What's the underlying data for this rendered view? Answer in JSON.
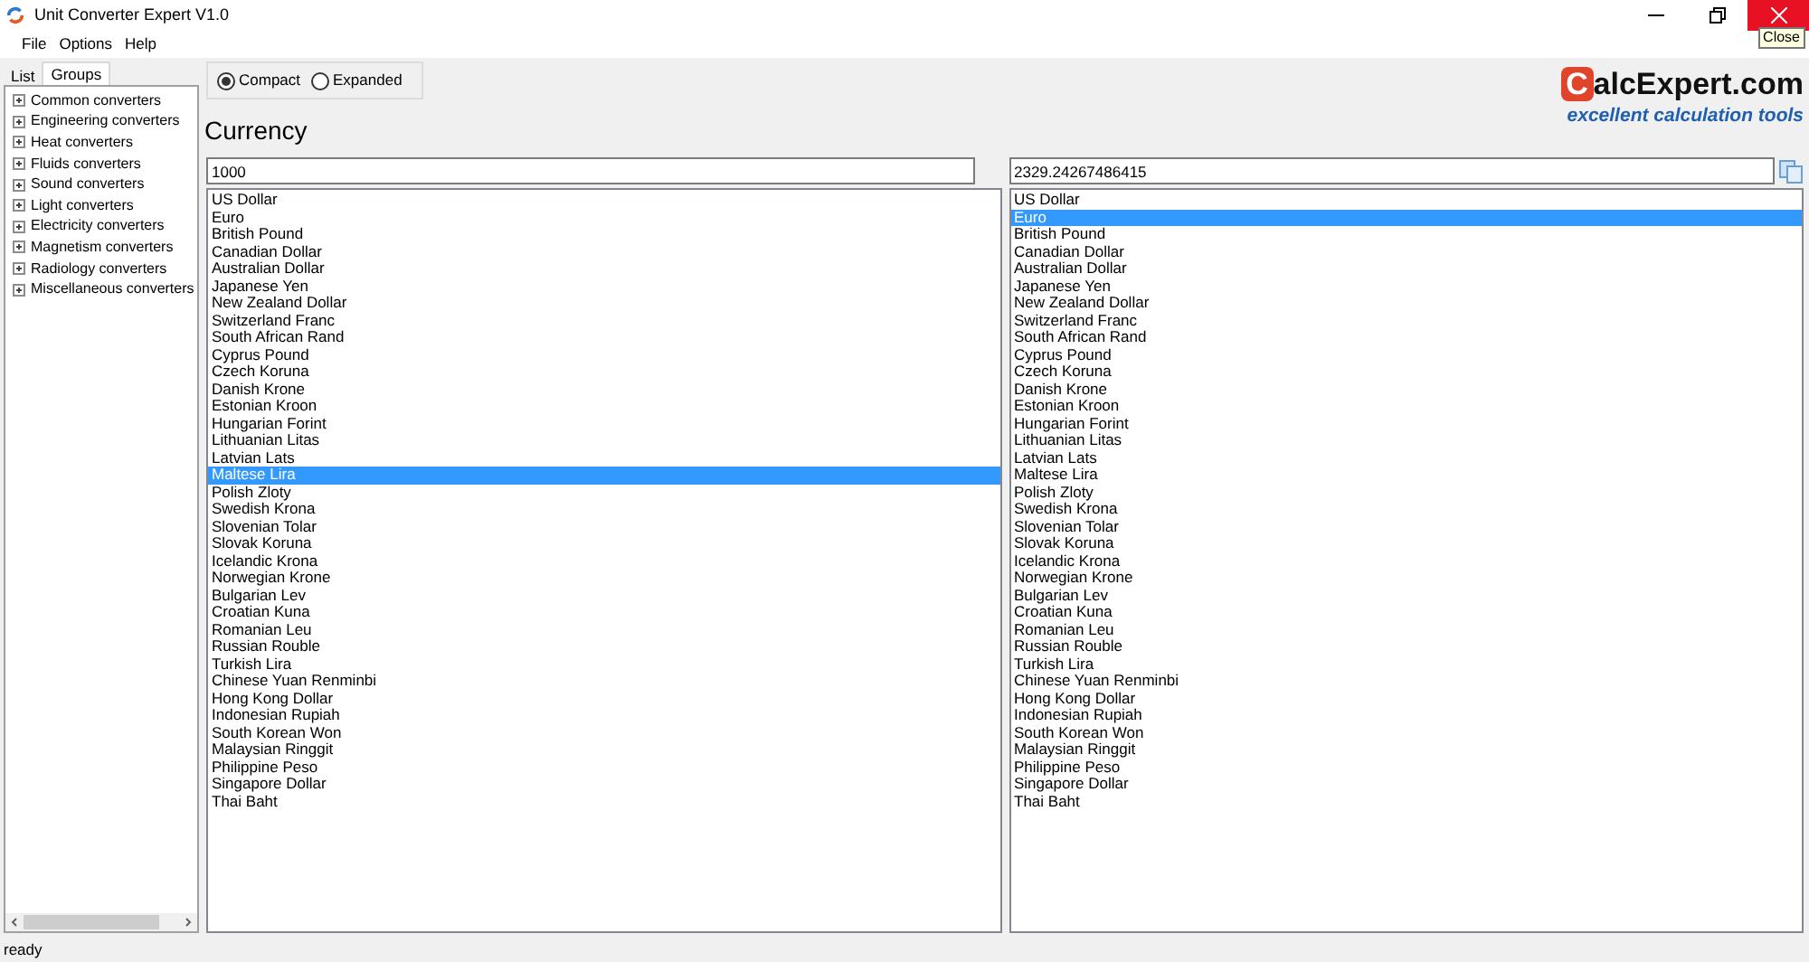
{
  "window": {
    "title": "Unit Converter Expert V1.0",
    "close_tooltip": "Close"
  },
  "menu": [
    "File",
    "Options",
    "Help"
  ],
  "sidebar": {
    "tabs": [
      {
        "label": "List",
        "selected": false
      },
      {
        "label": "Groups",
        "selected": true
      }
    ],
    "groups": [
      {
        "label": "Common converters",
        "expanded": false
      },
      {
        "label": "Engineering converters",
        "expanded": false
      },
      {
        "label": "Heat converters",
        "expanded": false
      },
      {
        "label": "Fluids converters",
        "expanded": false
      },
      {
        "label": "Sound converters",
        "expanded": false
      },
      {
        "label": "Light converters",
        "expanded": false
      },
      {
        "label": "Electricity converters",
        "expanded": false
      },
      {
        "label": "Magnetism converters",
        "expanded": false
      },
      {
        "label": "Radiology converters",
        "expanded": false
      },
      {
        "label": "Miscellaneous converters",
        "expanded": false
      }
    ]
  },
  "view_mode": [
    {
      "label": "Compact",
      "selected": true
    },
    {
      "label": "Expanded",
      "selected": false
    }
  ],
  "heading": "Currency",
  "logo": {
    "mark": "C",
    "name": "alcExpert.com",
    "tagline": "excellent calculation tools"
  },
  "from": {
    "value": "1000",
    "items": [
      {
        "label": "US Dollar",
        "selected": false
      },
      {
        "label": "Euro",
        "selected": false
      },
      {
        "label": "British Pound",
        "selected": false
      },
      {
        "label": "Canadian Dollar",
        "selected": false
      },
      {
        "label": "Australian Dollar",
        "selected": false
      },
      {
        "label": "Japanese Yen",
        "selected": false
      },
      {
        "label": "New Zealand Dollar",
        "selected": false
      },
      {
        "label": "Switzerland Franc",
        "selected": false
      },
      {
        "label": "South African Rand",
        "selected": false
      },
      {
        "label": "Cyprus Pound",
        "selected": false
      },
      {
        "label": "Czech Koruna",
        "selected": false
      },
      {
        "label": "Danish Krone",
        "selected": false
      },
      {
        "label": "Estonian Kroon",
        "selected": false
      },
      {
        "label": "Hungarian Forint",
        "selected": false
      },
      {
        "label": "Lithuanian Litas",
        "selected": false
      },
      {
        "label": "Latvian Lats",
        "selected": false
      },
      {
        "label": "Maltese Lira",
        "selected": true
      },
      {
        "label": "Polish Zloty",
        "selected": false
      },
      {
        "label": "Swedish Krona",
        "selected": false
      },
      {
        "label": "Slovenian Tolar",
        "selected": false
      },
      {
        "label": "Slovak Koruna",
        "selected": false
      },
      {
        "label": "Icelandic Krona",
        "selected": false
      },
      {
        "label": "Norwegian Krone",
        "selected": false
      },
      {
        "label": "Bulgarian Lev",
        "selected": false
      },
      {
        "label": "Croatian Kuna",
        "selected": false
      },
      {
        "label": "Romanian Leu",
        "selected": false
      },
      {
        "label": "Russian Rouble",
        "selected": false
      },
      {
        "label": "Turkish Lira",
        "selected": false
      },
      {
        "label": "Chinese Yuan Renminbi",
        "selected": false
      },
      {
        "label": "Hong Kong Dollar",
        "selected": false
      },
      {
        "label": "Indonesian Rupiah",
        "selected": false
      },
      {
        "label": "South Korean Won",
        "selected": false
      },
      {
        "label": "Malaysian Ringgit",
        "selected": false
      },
      {
        "label": "Philippine Peso",
        "selected": false
      },
      {
        "label": "Singapore Dollar",
        "selected": false
      },
      {
        "label": "Thai Baht",
        "selected": false
      }
    ]
  },
  "to": {
    "value": "2329.24267486415",
    "items": [
      {
        "label": "US Dollar",
        "selected": false
      },
      {
        "label": "Euro",
        "selected": true
      },
      {
        "label": "British Pound",
        "selected": false
      },
      {
        "label": "Canadian Dollar",
        "selected": false
      },
      {
        "label": "Australian Dollar",
        "selected": false
      },
      {
        "label": "Japanese Yen",
        "selected": false
      },
      {
        "label": "New Zealand Dollar",
        "selected": false
      },
      {
        "label": "Switzerland Franc",
        "selected": false
      },
      {
        "label": "South African Rand",
        "selected": false
      },
      {
        "label": "Cyprus Pound",
        "selected": false
      },
      {
        "label": "Czech Koruna",
        "selected": false
      },
      {
        "label": "Danish Krone",
        "selected": false
      },
      {
        "label": "Estonian Kroon",
        "selected": false
      },
      {
        "label": "Hungarian Forint",
        "selected": false
      },
      {
        "label": "Lithuanian Litas",
        "selected": false
      },
      {
        "label": "Latvian Lats",
        "selected": false
      },
      {
        "label": "Maltese Lira",
        "selected": false
      },
      {
        "label": "Polish Zloty",
        "selected": false
      },
      {
        "label": "Swedish Krona",
        "selected": false
      },
      {
        "label": "Slovenian Tolar",
        "selected": false
      },
      {
        "label": "Slovak Koruna",
        "selected": false
      },
      {
        "label": "Icelandic Krona",
        "selected": false
      },
      {
        "label": "Norwegian Krone",
        "selected": false
      },
      {
        "label": "Bulgarian Lev",
        "selected": false
      },
      {
        "label": "Croatian Kuna",
        "selected": false
      },
      {
        "label": "Romanian Leu",
        "selected": false
      },
      {
        "label": "Russian Rouble",
        "selected": false
      },
      {
        "label": "Turkish Lira",
        "selected": false
      },
      {
        "label": "Chinese Yuan Renminbi",
        "selected": false
      },
      {
        "label": "Hong Kong Dollar",
        "selected": false
      },
      {
        "label": "Indonesian Rupiah",
        "selected": false
      },
      {
        "label": "South Korean Won",
        "selected": false
      },
      {
        "label": "Malaysian Ringgit",
        "selected": false
      },
      {
        "label": "Philippine Peso",
        "selected": false
      },
      {
        "label": "Singapore Dollar",
        "selected": false
      },
      {
        "label": "Thai Baht",
        "selected": false
      }
    ]
  },
  "status_bar": "ready"
}
